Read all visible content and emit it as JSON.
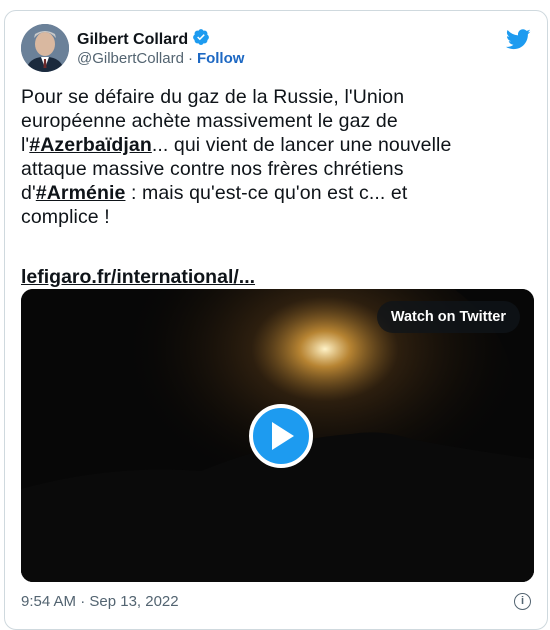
{
  "author": {
    "name": "Gilbert Collard",
    "handle": "@GilbertCollard",
    "follow_label": "Follow",
    "verified": true
  },
  "tweet": {
    "line1": "Pour se défaire du gaz de la Russie, l'Union",
    "line2": "européenne achète massivement le gaz de",
    "line3_prefix": "l'",
    "hashtag1": "#Azerbaïdjan",
    "line3_suffix": "... qui vient de lancer une nouvelle",
    "line4": "attaque massive contre nos frères chrétiens",
    "line5_prefix": "d'",
    "hashtag2": "#Arménie",
    "line5_suffix": " : mais qu'est-ce qu'on est c... et",
    "line6": "complice !",
    "link": "lefigaro.fr/international/..."
  },
  "media": {
    "watch_label": "Watch on Twitter"
  },
  "footer": {
    "timestamp": "9:54 AM · Sep 13, 2022",
    "info_icon": "i"
  },
  "colors": {
    "twitter_blue": "#1d9bf0",
    "follow_blue": "#1d68c3",
    "text": "#0f1419",
    "muted": "#536471"
  }
}
